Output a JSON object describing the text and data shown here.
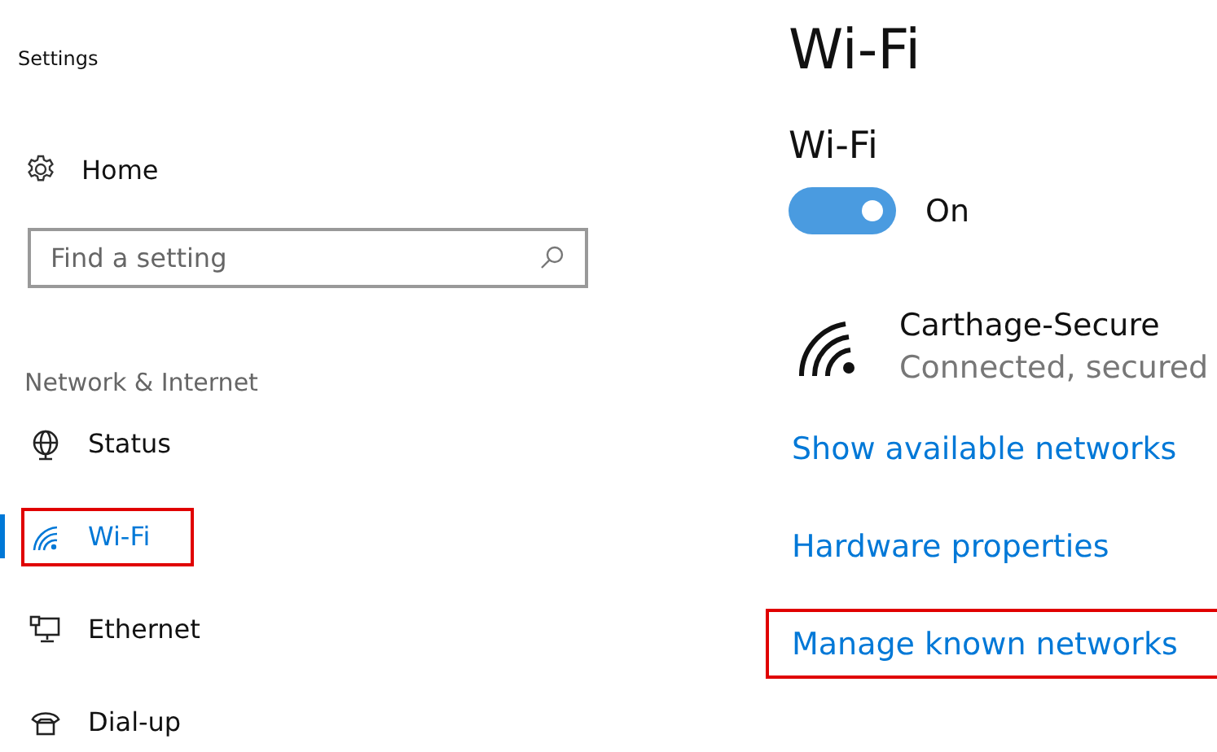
{
  "window": {
    "title": "Settings"
  },
  "home": {
    "label": "Home"
  },
  "search": {
    "placeholder": "Find a setting"
  },
  "section": "Network & Internet",
  "nav": [
    {
      "kind": "globe",
      "label": "Status",
      "selected": false,
      "highlighted": false
    },
    {
      "kind": "wifi",
      "label": "Wi-Fi",
      "selected": true,
      "highlighted": true
    },
    {
      "kind": "ethernet",
      "label": "Ethernet",
      "selected": false,
      "highlighted": false
    },
    {
      "kind": "phone",
      "label": "Dial-up",
      "selected": false,
      "highlighted": false
    }
  ],
  "page": {
    "title": "Wi-Fi",
    "subtitle": "Wi-Fi",
    "toggle": {
      "on": true,
      "label": "On"
    },
    "network": {
      "name": "Carthage-Secure",
      "status": "Connected, secured"
    },
    "links": [
      {
        "label": "Show available networks",
        "highlighted": false
      },
      {
        "label": "Hardware properties",
        "highlighted": false
      },
      {
        "label": "Manage known networks",
        "highlighted": true
      }
    ]
  }
}
